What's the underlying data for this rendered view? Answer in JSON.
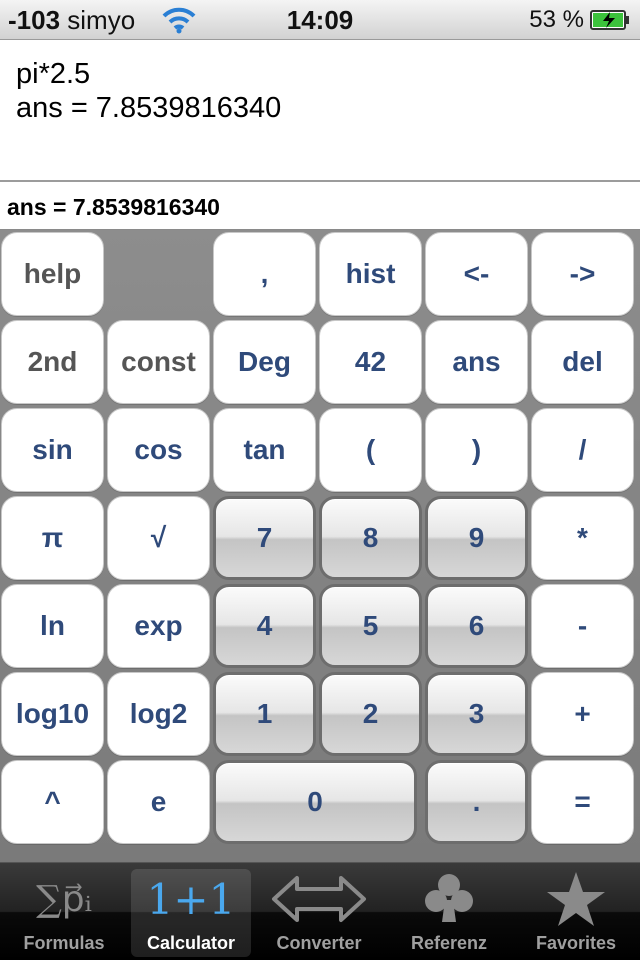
{
  "status_bar": {
    "signal": "-103",
    "carrier": "simyo",
    "time": "14:09",
    "battery": "53 %"
  },
  "display": {
    "input": "pi*2.5",
    "output": "ans = 7.8539816340"
  },
  "result": "ans = 7.8539816340",
  "keypad": {
    "help": "help",
    "comma": ",",
    "hist": "hist",
    "left": "<-",
    "right": "->",
    "second": "2nd",
    "const": "const",
    "deg": "Deg",
    "k42": "42",
    "ans": "ans",
    "del": "del",
    "sin": "sin",
    "cos": "cos",
    "tan": "tan",
    "lparen": "(",
    "rparen": ")",
    "div": "/",
    "pi": "π",
    "sqrt": "√",
    "k7": "7",
    "k8": "8",
    "k9": "9",
    "mul": "*",
    "ln": "ln",
    "exp": "exp",
    "k4": "4",
    "k5": "5",
    "k6": "6",
    "sub": "-",
    "log10": "log10",
    "log2": "log2",
    "k1": "1",
    "k2": "2",
    "k3": "3",
    "add": "+",
    "pow": "^",
    "e": "e",
    "k0": "0",
    "dot": ".",
    "eq": "="
  },
  "tabs": [
    {
      "label": "Formulas",
      "icon": "sum-vector-icon"
    },
    {
      "label": "Calculator",
      "icon": "one-plus-one-icon"
    },
    {
      "label": "Converter",
      "icon": "double-arrow-icon"
    },
    {
      "label": "Referenz",
      "icon": "club-icon"
    },
    {
      "label": "Favorites",
      "icon": "star-icon"
    }
  ],
  "tab_icon_glyphs": {
    "formulas": "∑p⃗ᵢ",
    "calculator": "1+1"
  },
  "colors": {
    "key_text": "#2f4a7a",
    "active_tab_icon": "#4aa8ee"
  }
}
